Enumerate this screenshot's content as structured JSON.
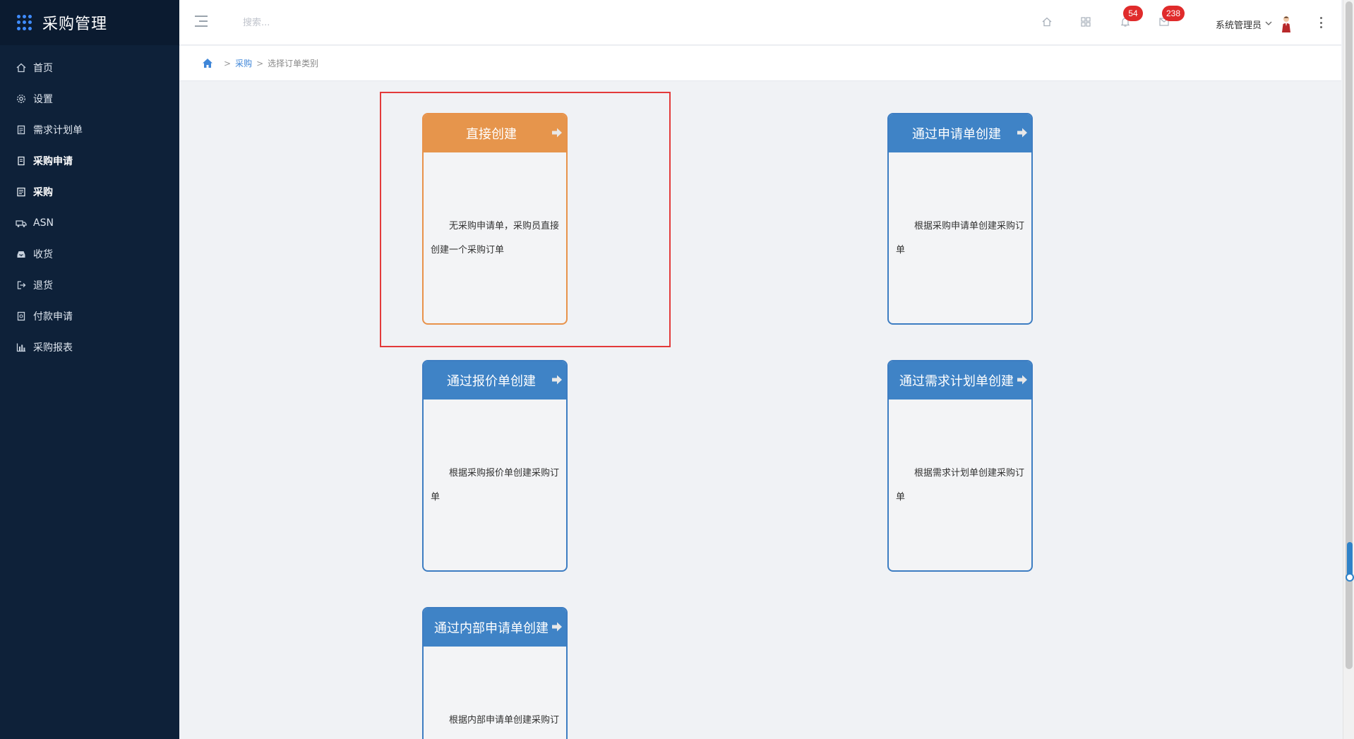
{
  "sidebar": {
    "title": "采购管理",
    "items": [
      {
        "label": "首页",
        "icon": "home-icon",
        "bold": false
      },
      {
        "label": "设置",
        "icon": "gear-icon",
        "bold": false
      },
      {
        "label": "需求计划单",
        "icon": "document-icon",
        "bold": false
      },
      {
        "label": "采购申请",
        "icon": "clipboard-icon",
        "bold": true
      },
      {
        "label": "采购",
        "icon": "list-icon",
        "bold": true
      },
      {
        "label": "ASN",
        "icon": "truck-icon",
        "bold": false
      },
      {
        "label": "收货",
        "icon": "inbox-icon",
        "bold": false
      },
      {
        "label": "退货",
        "icon": "logout-icon",
        "bold": false
      },
      {
        "label": "付款申请",
        "icon": "payment-icon",
        "bold": false
      },
      {
        "label": "采购报表",
        "icon": "bar-chart-icon",
        "bold": false
      }
    ]
  },
  "header": {
    "search_placeholder": "搜索...",
    "notifications_count": "54",
    "messages_count": "238",
    "user_name": "系统管理员"
  },
  "breadcrumb": {
    "link": "采购",
    "current": "选择订单类别"
  },
  "cards": [
    {
      "title": "直接创建",
      "desc": "无采购申请单，采购员直接创建一个采购订单",
      "style": "orange"
    },
    {
      "title": "通过申请单创建",
      "desc": "根据采购申请单创建采购订单",
      "style": "blue"
    },
    {
      "title": "通过报价单创建",
      "desc": "根据采购报价单创建采购订单",
      "style": "blue"
    },
    {
      "title": "通过需求计划单创建",
      "desc": "根据需求计划单创建采购订单",
      "style": "blue"
    },
    {
      "title": "通过内部申请单创建",
      "desc": "根据内部申请单创建采购订单",
      "style": "blue"
    }
  ],
  "colors": {
    "sidebar_bg": "#0e2139",
    "card_blue": "#3f83c6",
    "card_orange": "#e6954c",
    "highlight_red": "#e33a3a",
    "badge_red": "#e02b2b"
  }
}
